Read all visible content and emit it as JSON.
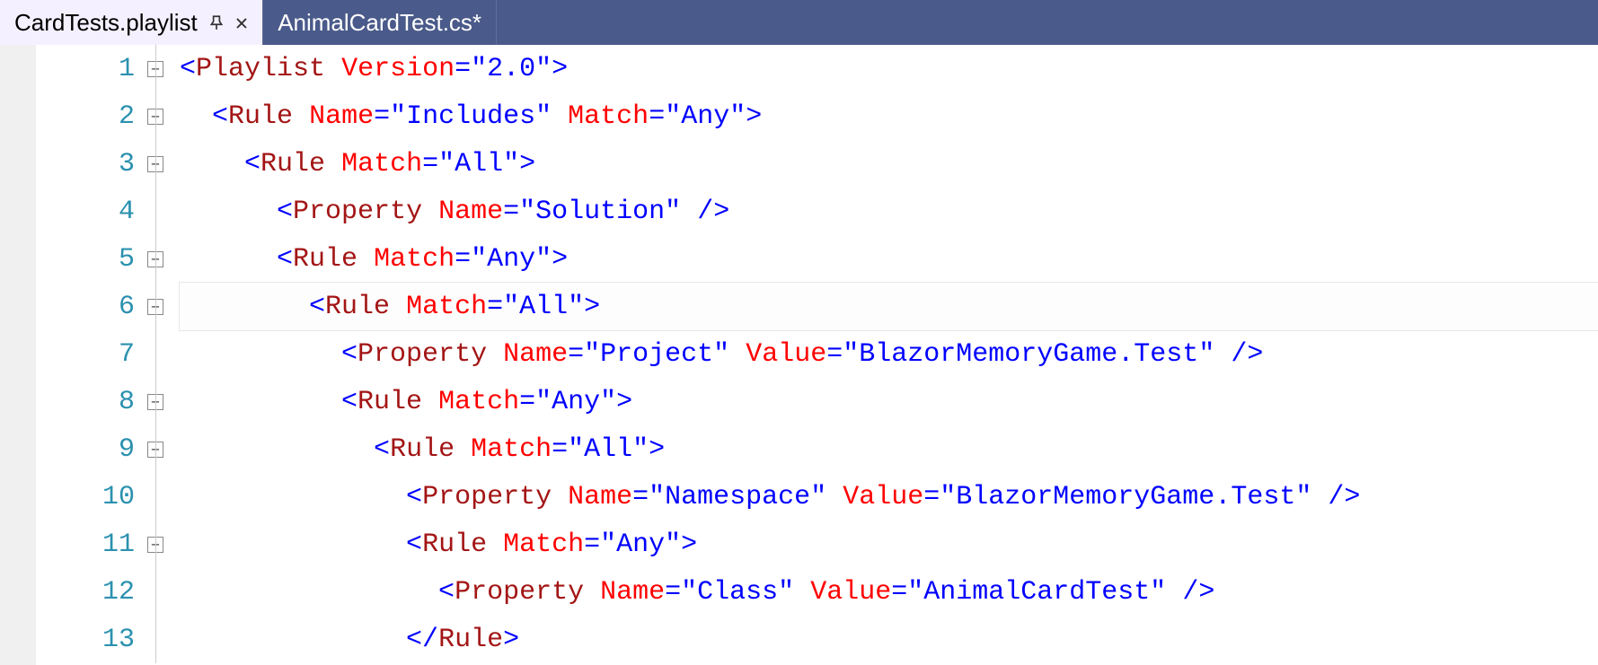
{
  "tabs": [
    {
      "label": "CardTests.playlist",
      "active": true,
      "pinned": true,
      "closable": true
    },
    {
      "label": "AnimalCardTest.cs*",
      "active": false,
      "pinned": false,
      "closable": false
    }
  ],
  "pin_glyph": "⟂",
  "close_glyph": "✕",
  "current_line": 6,
  "lines": [
    {
      "num": 1,
      "fold": "minus",
      "indent": 0,
      "tokens": [
        {
          "t": "punct",
          "v": "<"
        },
        {
          "t": "tag",
          "v": "Playlist"
        },
        {
          "t": "plain",
          "v": " "
        },
        {
          "t": "attr",
          "v": "Version"
        },
        {
          "t": "punct",
          "v": "="
        },
        {
          "t": "punct",
          "v": "\""
        },
        {
          "t": "val",
          "v": "2.0"
        },
        {
          "t": "punct",
          "v": "\""
        },
        {
          "t": "punct",
          "v": ">"
        }
      ]
    },
    {
      "num": 2,
      "fold": "minus",
      "indent": 1,
      "tokens": [
        {
          "t": "punct",
          "v": "<"
        },
        {
          "t": "tag",
          "v": "Rule"
        },
        {
          "t": "plain",
          "v": " "
        },
        {
          "t": "attr",
          "v": "Name"
        },
        {
          "t": "punct",
          "v": "="
        },
        {
          "t": "punct",
          "v": "\""
        },
        {
          "t": "val",
          "v": "Includes"
        },
        {
          "t": "punct",
          "v": "\""
        },
        {
          "t": "plain",
          "v": " "
        },
        {
          "t": "attr",
          "v": "Match"
        },
        {
          "t": "punct",
          "v": "="
        },
        {
          "t": "punct",
          "v": "\""
        },
        {
          "t": "val",
          "v": "Any"
        },
        {
          "t": "punct",
          "v": "\""
        },
        {
          "t": "punct",
          "v": ">"
        }
      ]
    },
    {
      "num": 3,
      "fold": "minus",
      "indent": 2,
      "tokens": [
        {
          "t": "punct",
          "v": "<"
        },
        {
          "t": "tag",
          "v": "Rule"
        },
        {
          "t": "plain",
          "v": " "
        },
        {
          "t": "attr",
          "v": "Match"
        },
        {
          "t": "punct",
          "v": "="
        },
        {
          "t": "punct",
          "v": "\""
        },
        {
          "t": "val",
          "v": "All"
        },
        {
          "t": "punct",
          "v": "\""
        },
        {
          "t": "punct",
          "v": ">"
        }
      ]
    },
    {
      "num": 4,
      "fold": "line",
      "indent": 3,
      "tokens": [
        {
          "t": "punct",
          "v": "<"
        },
        {
          "t": "tag",
          "v": "Property"
        },
        {
          "t": "plain",
          "v": " "
        },
        {
          "t": "attr",
          "v": "Name"
        },
        {
          "t": "punct",
          "v": "="
        },
        {
          "t": "punct",
          "v": "\""
        },
        {
          "t": "val",
          "v": "Solution"
        },
        {
          "t": "punct",
          "v": "\""
        },
        {
          "t": "plain",
          "v": " "
        },
        {
          "t": "punct",
          "v": "/>"
        }
      ]
    },
    {
      "num": 5,
      "fold": "minus",
      "indent": 3,
      "tokens": [
        {
          "t": "punct",
          "v": "<"
        },
        {
          "t": "tag",
          "v": "Rule"
        },
        {
          "t": "plain",
          "v": " "
        },
        {
          "t": "attr",
          "v": "Match"
        },
        {
          "t": "punct",
          "v": "="
        },
        {
          "t": "punct",
          "v": "\""
        },
        {
          "t": "val",
          "v": "Any"
        },
        {
          "t": "punct",
          "v": "\""
        },
        {
          "t": "punct",
          "v": ">"
        }
      ]
    },
    {
      "num": 6,
      "fold": "minus",
      "indent": 4,
      "tokens": [
        {
          "t": "punct",
          "v": "<"
        },
        {
          "t": "tag",
          "v": "Rule"
        },
        {
          "t": "plain",
          "v": " "
        },
        {
          "t": "attr",
          "v": "Match"
        },
        {
          "t": "punct",
          "v": "="
        },
        {
          "t": "punct",
          "v": "\""
        },
        {
          "t": "val",
          "v": "All"
        },
        {
          "t": "punct",
          "v": "\""
        },
        {
          "t": "punct",
          "v": ">"
        }
      ]
    },
    {
      "num": 7,
      "fold": "line",
      "indent": 5,
      "tokens": [
        {
          "t": "punct",
          "v": "<"
        },
        {
          "t": "tag",
          "v": "Property"
        },
        {
          "t": "plain",
          "v": " "
        },
        {
          "t": "attr",
          "v": "Name"
        },
        {
          "t": "punct",
          "v": "="
        },
        {
          "t": "punct",
          "v": "\""
        },
        {
          "t": "val",
          "v": "Project"
        },
        {
          "t": "punct",
          "v": "\""
        },
        {
          "t": "plain",
          "v": " "
        },
        {
          "t": "attr",
          "v": "Value"
        },
        {
          "t": "punct",
          "v": "="
        },
        {
          "t": "punct",
          "v": "\""
        },
        {
          "t": "val",
          "v": "BlazorMemoryGame.Test"
        },
        {
          "t": "punct",
          "v": "\""
        },
        {
          "t": "plain",
          "v": " "
        },
        {
          "t": "punct",
          "v": "/>"
        }
      ]
    },
    {
      "num": 8,
      "fold": "minus",
      "indent": 5,
      "tokens": [
        {
          "t": "punct",
          "v": "<"
        },
        {
          "t": "tag",
          "v": "Rule"
        },
        {
          "t": "plain",
          "v": " "
        },
        {
          "t": "attr",
          "v": "Match"
        },
        {
          "t": "punct",
          "v": "="
        },
        {
          "t": "punct",
          "v": "\""
        },
        {
          "t": "val",
          "v": "Any"
        },
        {
          "t": "punct",
          "v": "\""
        },
        {
          "t": "punct",
          "v": ">"
        }
      ]
    },
    {
      "num": 9,
      "fold": "minus",
      "indent": 6,
      "tokens": [
        {
          "t": "punct",
          "v": "<"
        },
        {
          "t": "tag",
          "v": "Rule"
        },
        {
          "t": "plain",
          "v": " "
        },
        {
          "t": "attr",
          "v": "Match"
        },
        {
          "t": "punct",
          "v": "="
        },
        {
          "t": "punct",
          "v": "\""
        },
        {
          "t": "val",
          "v": "All"
        },
        {
          "t": "punct",
          "v": "\""
        },
        {
          "t": "punct",
          "v": ">"
        }
      ]
    },
    {
      "num": 10,
      "fold": "line",
      "indent": 7,
      "tokens": [
        {
          "t": "punct",
          "v": "<"
        },
        {
          "t": "tag",
          "v": "Property"
        },
        {
          "t": "plain",
          "v": " "
        },
        {
          "t": "attr",
          "v": "Name"
        },
        {
          "t": "punct",
          "v": "="
        },
        {
          "t": "punct",
          "v": "\""
        },
        {
          "t": "val",
          "v": "Namespace"
        },
        {
          "t": "punct",
          "v": "\""
        },
        {
          "t": "plain",
          "v": " "
        },
        {
          "t": "attr",
          "v": "Value"
        },
        {
          "t": "punct",
          "v": "="
        },
        {
          "t": "punct",
          "v": "\""
        },
        {
          "t": "val",
          "v": "BlazorMemoryGame.Test"
        },
        {
          "t": "punct",
          "v": "\""
        },
        {
          "t": "plain",
          "v": " "
        },
        {
          "t": "punct",
          "v": "/>"
        }
      ]
    },
    {
      "num": 11,
      "fold": "minus",
      "indent": 7,
      "tokens": [
        {
          "t": "punct",
          "v": "<"
        },
        {
          "t": "tag",
          "v": "Rule"
        },
        {
          "t": "plain",
          "v": " "
        },
        {
          "t": "attr",
          "v": "Match"
        },
        {
          "t": "punct",
          "v": "="
        },
        {
          "t": "punct",
          "v": "\""
        },
        {
          "t": "val",
          "v": "Any"
        },
        {
          "t": "punct",
          "v": "\""
        },
        {
          "t": "punct",
          "v": ">"
        }
      ]
    },
    {
      "num": 12,
      "fold": "line",
      "indent": 8,
      "tokens": [
        {
          "t": "punct",
          "v": "<"
        },
        {
          "t": "tag",
          "v": "Property"
        },
        {
          "t": "plain",
          "v": " "
        },
        {
          "t": "attr",
          "v": "Name"
        },
        {
          "t": "punct",
          "v": "="
        },
        {
          "t": "punct",
          "v": "\""
        },
        {
          "t": "val",
          "v": "Class"
        },
        {
          "t": "punct",
          "v": "\""
        },
        {
          "t": "plain",
          "v": " "
        },
        {
          "t": "attr",
          "v": "Value"
        },
        {
          "t": "punct",
          "v": "="
        },
        {
          "t": "punct",
          "v": "\""
        },
        {
          "t": "val",
          "v": "AnimalCardTest"
        },
        {
          "t": "punct",
          "v": "\""
        },
        {
          "t": "plain",
          "v": " "
        },
        {
          "t": "punct",
          "v": "/>"
        }
      ]
    },
    {
      "num": 13,
      "fold": "line",
      "indent": 7,
      "tokens": [
        {
          "t": "punct",
          "v": "</"
        },
        {
          "t": "tag",
          "v": "Rule"
        },
        {
          "t": "punct",
          "v": ">"
        }
      ]
    }
  ]
}
